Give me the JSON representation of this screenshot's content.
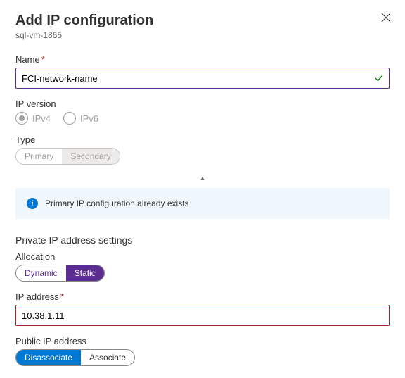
{
  "header": {
    "title": "Add IP configuration",
    "subtitle": "sql-vm-1865"
  },
  "name": {
    "label": "Name",
    "value": "FCI-network-name",
    "required": true,
    "valid": true
  },
  "ipVersion": {
    "label": "IP version",
    "options": {
      "ipv4": "IPv4",
      "ipv6": "IPv6"
    }
  },
  "type": {
    "label": "Type",
    "options": {
      "primary": "Primary",
      "secondary": "Secondary"
    }
  },
  "banner": {
    "text": "Primary IP configuration already exists"
  },
  "privateSection": {
    "heading": "Private IP address settings",
    "allocation": {
      "label": "Allocation",
      "options": {
        "dynamic": "Dynamic",
        "static": "Static"
      }
    },
    "ipAddress": {
      "label": "IP address",
      "value": "10.38.1.11",
      "required": true
    }
  },
  "publicIp": {
    "label": "Public IP address",
    "options": {
      "disassociate": "Disassociate",
      "associate": "Associate"
    }
  }
}
